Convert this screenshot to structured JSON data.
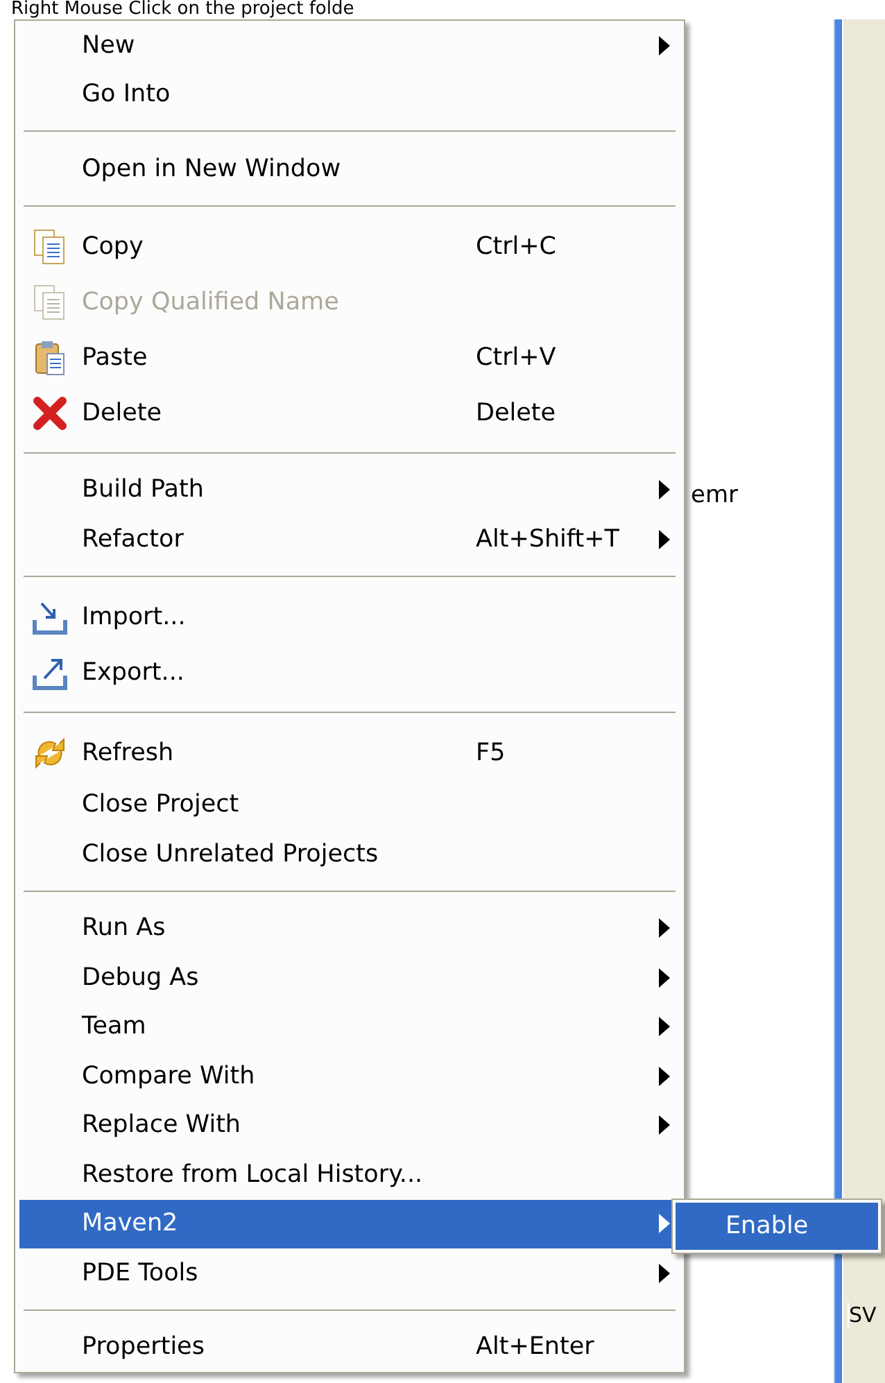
{
  "caption": "Right Mouse Click on the project folde",
  "tree_text": "emr",
  "panel_text": "SV",
  "menu": [
    {
      "kind": "item",
      "label": "New",
      "submenu": true
    },
    {
      "kind": "item",
      "label": "Go Into"
    },
    {
      "kind": "separator"
    },
    {
      "kind": "item",
      "label": "Open in New Window"
    },
    {
      "kind": "separator"
    },
    {
      "kind": "item",
      "label": "Copy",
      "shortcut": "Ctrl+C"
    },
    {
      "kind": "item",
      "label": "Copy Qualified Name",
      "disabled": true
    },
    {
      "kind": "item",
      "label": "Paste",
      "shortcut": "Ctrl+V"
    },
    {
      "kind": "item",
      "label": "Delete",
      "shortcut": "Delete"
    },
    {
      "kind": "separator"
    },
    {
      "kind": "item",
      "label": "Build Path",
      "submenu": true
    },
    {
      "kind": "item",
      "label": "Refactor",
      "shortcut": "Alt+Shift+T",
      "submenu": true
    },
    {
      "kind": "separator"
    },
    {
      "kind": "item",
      "label": "Import..."
    },
    {
      "kind": "item",
      "label": "Export..."
    },
    {
      "kind": "separator"
    },
    {
      "kind": "item",
      "label": "Refresh",
      "shortcut": "F5"
    },
    {
      "kind": "item",
      "label": "Close Project"
    },
    {
      "kind": "item",
      "label": "Close Unrelated Projects"
    },
    {
      "kind": "separator"
    },
    {
      "kind": "item",
      "label": "Run As",
      "submenu": true
    },
    {
      "kind": "item",
      "label": "Debug As",
      "submenu": true
    },
    {
      "kind": "item",
      "label": "Team",
      "submenu": true
    },
    {
      "kind": "item",
      "label": "Compare With",
      "submenu": true
    },
    {
      "kind": "item",
      "label": "Replace With",
      "submenu": true
    },
    {
      "kind": "item",
      "label": "Restore from Local History..."
    },
    {
      "kind": "item",
      "label": "Maven2",
      "submenu": true,
      "selected": true
    },
    {
      "kind": "item",
      "label": "PDE Tools",
      "submenu": true
    },
    {
      "kind": "separator"
    },
    {
      "kind": "item",
      "label": "Properties",
      "shortcut": "Alt+Enter"
    }
  ],
  "submenu": [
    {
      "label": "Enable",
      "selected": true
    }
  ]
}
